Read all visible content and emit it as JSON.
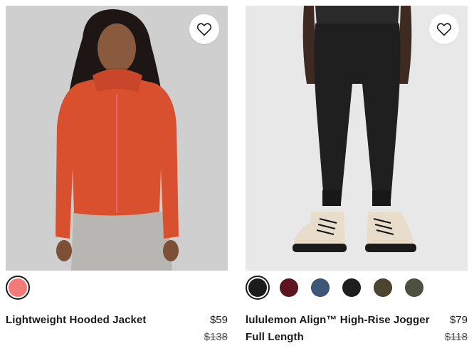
{
  "products": [
    {
      "name": "Lightweight Hooded Jacket",
      "price": "$59",
      "old_price": "$138",
      "swatches": [
        {
          "name": "coral",
          "color": "#f47a7a",
          "selected": true
        }
      ]
    },
    {
      "name": "lululemon Align™ High-Rise Jogger Full Length",
      "price": "$79",
      "old_price": "$118",
      "swatches": [
        {
          "name": "black",
          "color": "#1c1c1c",
          "selected": true
        },
        {
          "name": "burgundy",
          "color": "#5e1420",
          "selected": false
        },
        {
          "name": "navy-blue",
          "color": "#3e5677",
          "selected": false
        },
        {
          "name": "black-2",
          "color": "#1e1e1e",
          "selected": false
        },
        {
          "name": "olive-brown",
          "color": "#4b4530",
          "selected": false
        },
        {
          "name": "olive-green",
          "color": "#4d5140",
          "selected": false
        }
      ]
    }
  ],
  "icons": {
    "wishlist": "heart-outline-icon"
  },
  "colors": {
    "jacket": "#d9502f",
    "jogger": "#1f1f1f"
  }
}
